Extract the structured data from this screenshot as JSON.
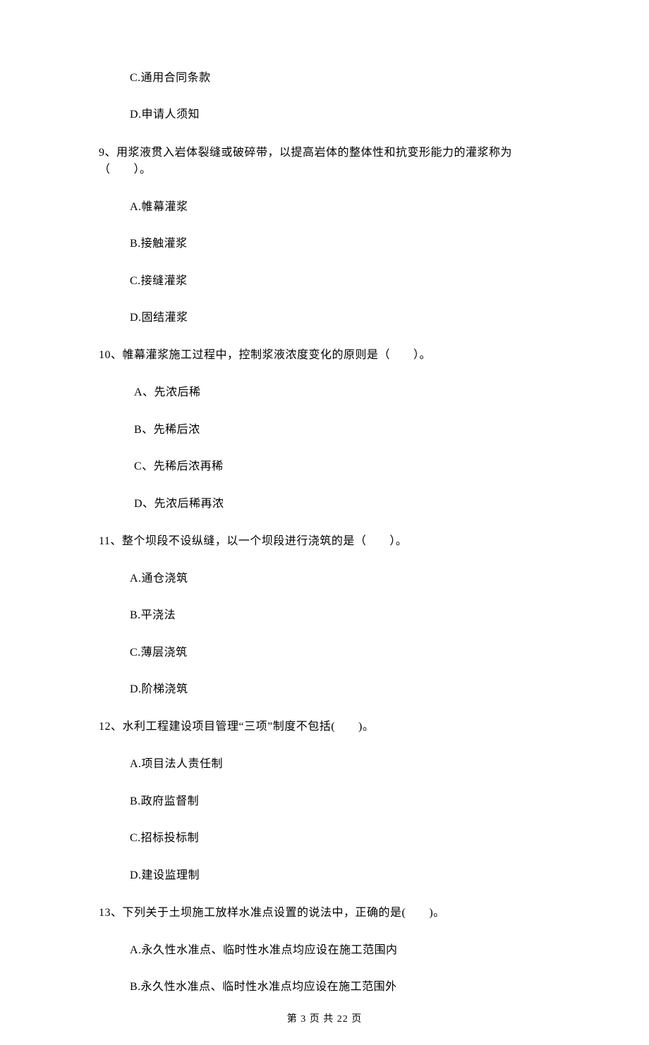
{
  "q8": {
    "options": {
      "C": "C.通用合同条款",
      "D": "D.申请人须知"
    }
  },
  "q9": {
    "text": "9、用浆液贯入岩体裂缝或破碎带，以提高岩体的整体性和抗变形能力的灌浆称为（　　）。",
    "options": {
      "A": "A.帷幕灌浆",
      "B": "B.接触灌浆",
      "C": "C.接缝灌浆",
      "D": "D.固结灌浆"
    }
  },
  "q10": {
    "text": "10、帷幕灌浆施工过程中，控制浆液浓度变化的原则是（　　）。",
    "options": {
      "A": "A、先浓后稀",
      "B": "B、先稀后浓",
      "C": "C、先稀后浓再稀",
      "D": "D、先浓后稀再浓"
    }
  },
  "q11": {
    "text": "11、整个坝段不设纵缝，以一个坝段进行浇筑的是（　　）。",
    "options": {
      "A": "A.通仓浇筑",
      "B": "B.平浇法",
      "C": "C.薄层浇筑",
      "D": "D.阶梯浇筑"
    }
  },
  "q12": {
    "text": "12、水利工程建设项目管理“三项”制度不包括(　　)。",
    "options": {
      "A": "A.项目法人责任制",
      "B": "B.政府监督制",
      "C": "C.招标投标制",
      "D": "D.建设监理制"
    }
  },
  "q13": {
    "text": "13、下列关于土坝施工放样水准点设置的说法中，正确的是(　　)。",
    "options": {
      "A": "A.永久性水准点、临时性水准点均应设在施工范围内",
      "B": "B.永久性水准点、临时性水准点均应设在施工范围外"
    }
  },
  "footer": "第 3 页 共 22 页"
}
